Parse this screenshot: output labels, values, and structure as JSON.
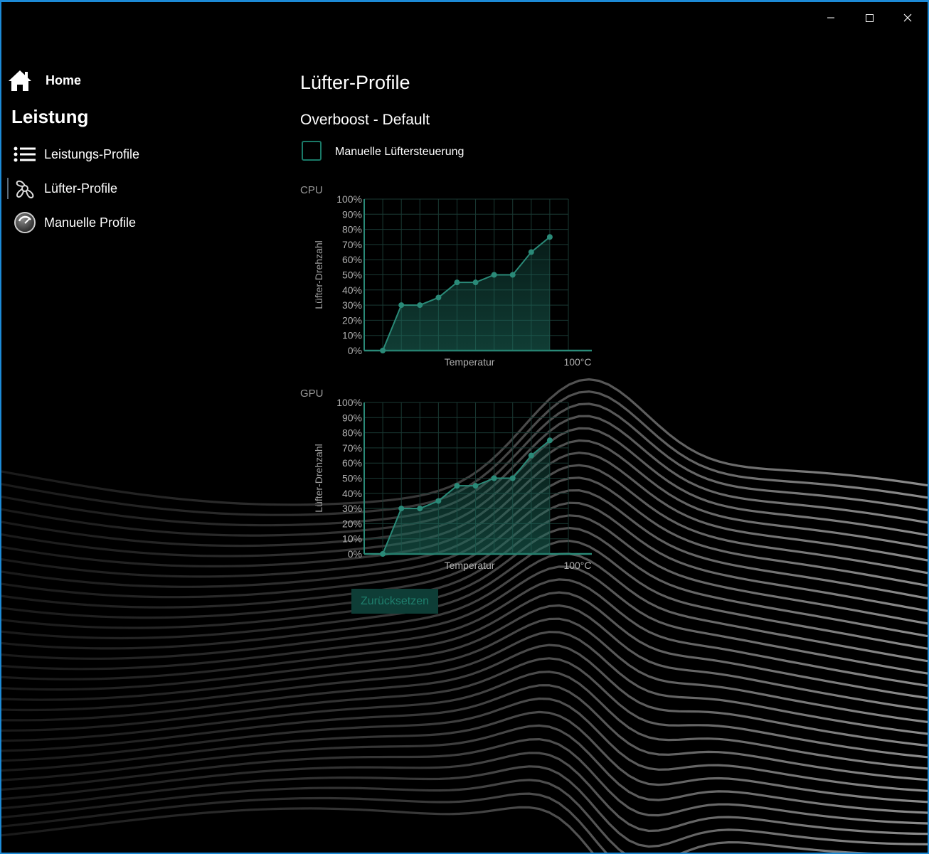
{
  "window": {
    "controls": {
      "minimize": "minimize-icon",
      "maximize": "maximize-icon",
      "close": "close-icon"
    }
  },
  "sidebar": {
    "home_label": "Home",
    "section_title": "Leistung",
    "items": [
      {
        "label": "Leistungs-Profile",
        "icon": "list-icon",
        "active": false
      },
      {
        "label": "Lüfter-Profile",
        "icon": "fan-icon",
        "active": true
      },
      {
        "label": "Manuelle Profile",
        "icon": "gauge-icon",
        "active": false
      }
    ]
  },
  "main": {
    "page_title": "Lüfter-Profile",
    "profile_name": "Overboost - Default",
    "manual_checkbox": {
      "label": "Manuelle Lüftersteuerung",
      "checked": false
    },
    "reset_label": "Zurücksetzen"
  },
  "colors": {
    "accent": "#1f7f6d",
    "line": "#2a8a78",
    "grid": "#1a3a34"
  },
  "chart_data": [
    {
      "type": "line",
      "title": "CPU",
      "ylabel": "Lüfter-Drehzahl",
      "xlabel": "Temperatur",
      "x_end_label": "100°C",
      "ytick_labels": [
        "100%",
        "90%",
        "80%",
        "70%",
        "60%",
        "50%",
        "40%",
        "30%",
        "20%",
        "10%",
        "0%"
      ],
      "ylim": [
        0,
        100
      ],
      "grid": true,
      "values": [
        0,
        30,
        30,
        35,
        45,
        45,
        50,
        50,
        65,
        75
      ]
    },
    {
      "type": "line",
      "title": "GPU",
      "ylabel": "Lüfter-Drehzahl",
      "xlabel": "Temperatur",
      "x_end_label": "100°C",
      "ytick_labels": [
        "100%",
        "90%",
        "80%",
        "70%",
        "60%",
        "50%",
        "40%",
        "30%",
        "20%",
        "10%",
        "0%"
      ],
      "ylim": [
        0,
        100
      ],
      "grid": true,
      "values": [
        0,
        30,
        30,
        35,
        45,
        45,
        50,
        50,
        65,
        75
      ]
    }
  ]
}
